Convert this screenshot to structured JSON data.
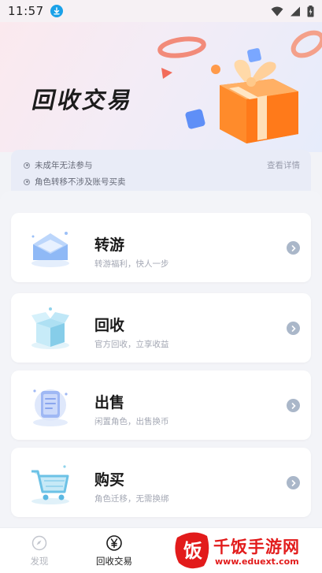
{
  "status_bar": {
    "time": "11:57",
    "icons": [
      "download-icon",
      "wifi-icon",
      "signal-icon",
      "battery-icon"
    ]
  },
  "hero": {
    "title": "回收交易",
    "illustration": "gift-box-icon"
  },
  "notice": {
    "items": [
      "未成年无法参与",
      "角色转移不涉及账号买卖"
    ],
    "link": "查看详情"
  },
  "cards": [
    {
      "title": "转游",
      "subtitle": "转游福利，快人一步",
      "icon": "envelope-icon"
    },
    {
      "title": "回收",
      "subtitle": "官方回收，立享收益",
      "icon": "box-icon"
    },
    {
      "title": "出售",
      "subtitle": "闲置角色，出售换币",
      "icon": "document-icon"
    },
    {
      "title": "购买",
      "subtitle": "角色迁移，无需换绑",
      "icon": "cart-icon"
    }
  ],
  "bottom_nav": [
    {
      "label": "发现",
      "icon": "discover-icon",
      "active": false
    },
    {
      "label": "回收交易",
      "icon": "yen-icon",
      "active": true
    }
  ],
  "watermark": {
    "brand": "千饭手游网",
    "url": "www.eduext.com",
    "logo_char": "饭"
  },
  "colors": {
    "accent_blue": "#1aa1e8",
    "arrow": "#aab7c9",
    "watermark_red": "#e21b1b"
  }
}
